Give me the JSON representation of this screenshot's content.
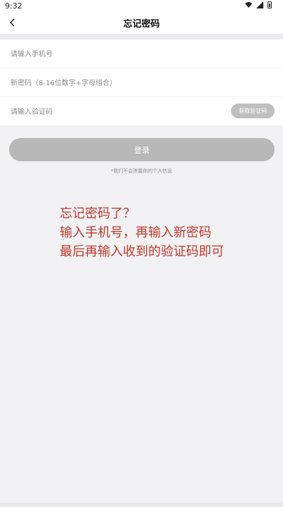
{
  "status": {
    "time": "9:32"
  },
  "header": {
    "title": "忘记密码"
  },
  "form": {
    "phone_placeholder": "请输入手机号",
    "password_placeholder": "新密码（8-16位数字+字母组合）",
    "code_placeholder": "请输入验证码",
    "get_code_label": "获取验证码"
  },
  "actions": {
    "login_label": "登录",
    "privacy_note": "*我们不会泄露你的个人信息"
  },
  "hint": {
    "line1": "忘记密码了？",
    "line2": "输入手机号，再输入新密码",
    "line3": "最后再输入收到的验证码即可"
  },
  "colors": {
    "hint_red": "#c0392b",
    "disabled_gray": "#b8b8b8"
  }
}
